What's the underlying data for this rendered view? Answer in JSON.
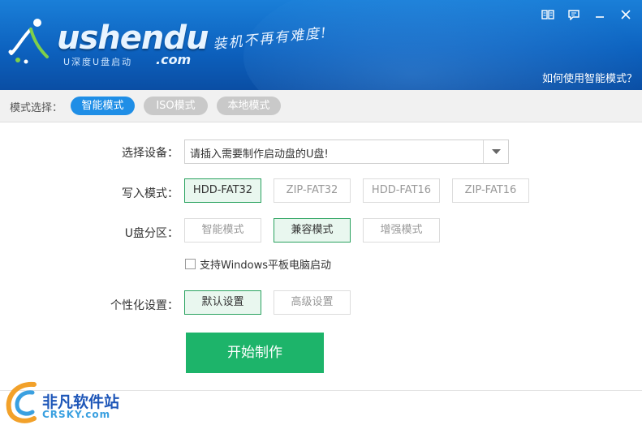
{
  "header": {
    "logo_main": "ushendu",
    "logo_sub": "U深度U盘启动",
    "logo_com": ".com",
    "slogan": "装机不再有难度!",
    "help_link": "如何使用智能模式？",
    "window_controls": [
      "book-icon",
      "feedback-icon",
      "minimize-icon",
      "close-icon"
    ]
  },
  "modebar": {
    "label": "模式选择：",
    "modes": [
      {
        "label": "智能模式",
        "active": true
      },
      {
        "label": "ISO模式",
        "active": false
      },
      {
        "label": "本地模式",
        "active": false
      }
    ]
  },
  "form": {
    "device": {
      "label": "选择设备：",
      "value": "请插入需要制作启动盘的U盘!"
    },
    "write_mode": {
      "label": "写入模式：",
      "options": [
        "HDD-FAT32",
        "ZIP-FAT32",
        "HDD-FAT16",
        "ZIP-FAT16"
      ],
      "selected": "HDD-FAT32"
    },
    "partition": {
      "label": "U盘分区：",
      "options": [
        "智能模式",
        "兼容模式",
        "增强模式"
      ],
      "selected": "兼容模式"
    },
    "tablet_checkbox": {
      "label": "支持Windows平板电脑启动",
      "checked": false
    },
    "personalize": {
      "label": "个性化设置：",
      "options": [
        "默认设置",
        "高级设置"
      ],
      "selected": "默认设置"
    },
    "start_button": "开始制作"
  },
  "watermark": {
    "text": "非凡软件站",
    "url": "CRSKY.com"
  },
  "colors": {
    "header_blue": "#0d62bf",
    "active_pill": "#1f8ee6",
    "selected_green": "#2aa25f",
    "start_green": "#1db46a"
  }
}
